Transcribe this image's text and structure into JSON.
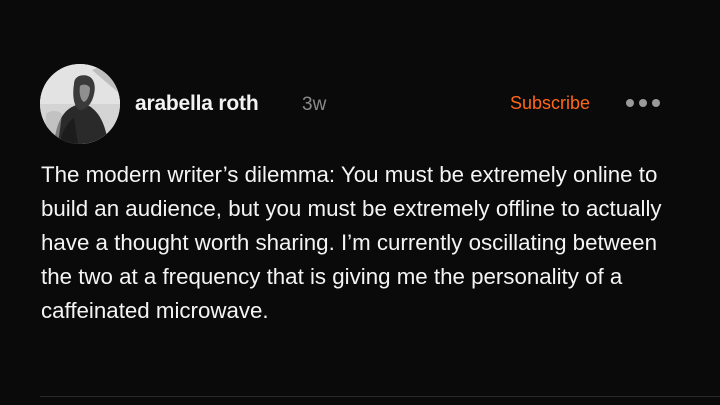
{
  "post": {
    "author": "arabella roth",
    "timestamp": "3w",
    "subscribe_label": "Subscribe",
    "body": "The modern writer’s dilemma: You must be extremely online to build an audience, but you must be extremely offline to actually have a thought worth sharing. I’m currently oscillating between the two at a frequency that is giving me the personality of a caffeinated microwave."
  },
  "icons": {
    "more": "more-options-icon",
    "avatar": "avatar"
  },
  "colors": {
    "background": "#0a0a0a",
    "accent": "#ff6719",
    "text": "#f4f4f4",
    "muted": "#8a8a8a"
  }
}
